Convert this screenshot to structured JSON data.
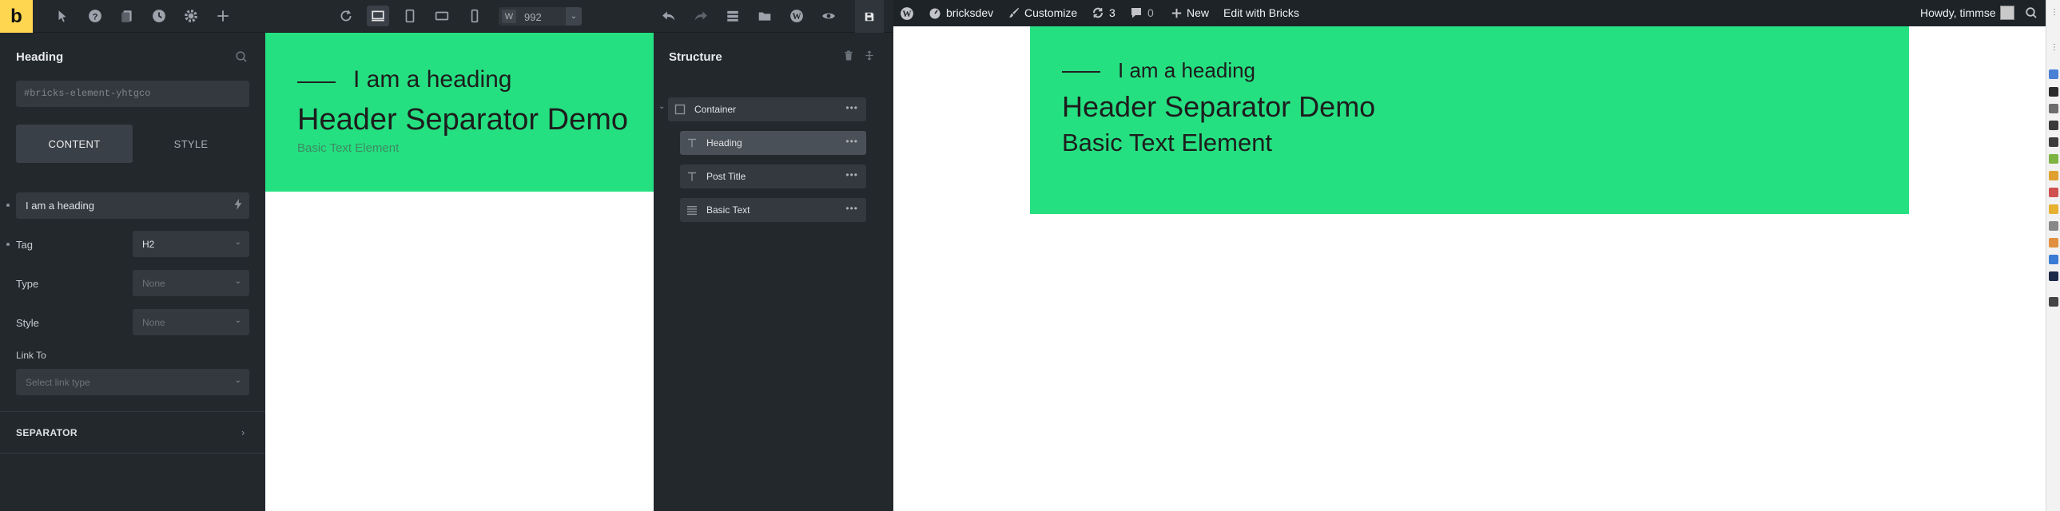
{
  "builder": {
    "logo": "b",
    "toolbar": {
      "width_label": "W",
      "width_value": "992"
    }
  },
  "left_panel": {
    "title": "Heading",
    "element_id_placeholder": "#bricks-element-yhtgco",
    "tabs": [
      {
        "label": "CONTENT",
        "active": true
      },
      {
        "label": "STYLE",
        "active": false
      }
    ],
    "text_value": "I am a heading",
    "fields": [
      {
        "label": "Tag",
        "value": "H2",
        "placeholder": false
      },
      {
        "label": "Type",
        "value": "None",
        "placeholder": true
      },
      {
        "label": "Style",
        "value": "None",
        "placeholder": true
      }
    ],
    "link_to": {
      "label": "Link To",
      "placeholder": "Select link type"
    },
    "separator_section": "SEPARATOR"
  },
  "canvas": {
    "heading_small": "I am a heading",
    "heading_big": "Header Separator Demo",
    "basic_text": "Basic Text Element",
    "background_color": "#25e081"
  },
  "structure": {
    "title": "Structure",
    "items": [
      {
        "label": "Container",
        "icon": "square-icon",
        "active": false
      },
      {
        "label": "Heading",
        "icon": "text-t-icon",
        "active": true
      },
      {
        "label": "Post Title",
        "icon": "text-t-icon",
        "active": false
      },
      {
        "label": "Basic Text",
        "icon": "lines-icon",
        "active": false
      }
    ]
  },
  "wp_admin_bar": {
    "site_name": "bricksdev",
    "customize": "Customize",
    "updates_count": "3",
    "comments_count": "0",
    "new": "New",
    "edit_with": "Edit with Bricks",
    "greeting": "Howdy, timmse"
  },
  "frontend": {
    "heading_small": "I am a heading",
    "heading_big": "Header Separator Demo",
    "basic_text": "Basic Text Element"
  },
  "colors": {
    "accent_green": "#25e081",
    "builder_dark": "#23282d",
    "bricks_yellow": "#ffd64f",
    "wp_bar": "#1d2327"
  }
}
